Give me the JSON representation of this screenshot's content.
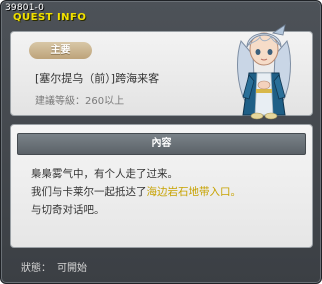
{
  "window": {
    "id_text": "39801-0",
    "title": "QUEST INFO"
  },
  "quest": {
    "category": "主要",
    "name": "[塞尔提乌（前）]跨海来客",
    "recommended_level": "建議等級：260以上"
  },
  "content": {
    "header": "內容",
    "line1": "梟梟雾气中，有个人走了过来。",
    "line2_prefix": "我们与卡莱尔一起抵达了",
    "line2_highlight": "海边岩石地带入口。",
    "line3": "与切奇对话吧。"
  },
  "status": {
    "label": "狀態：",
    "value": "可開始"
  },
  "colors": {
    "title_yellow": "#f2e100",
    "highlight_gold": "#c7a200",
    "badge_tan": "#c9b08a"
  },
  "icons": {
    "portrait": "silver-haired-npc-portrait"
  }
}
